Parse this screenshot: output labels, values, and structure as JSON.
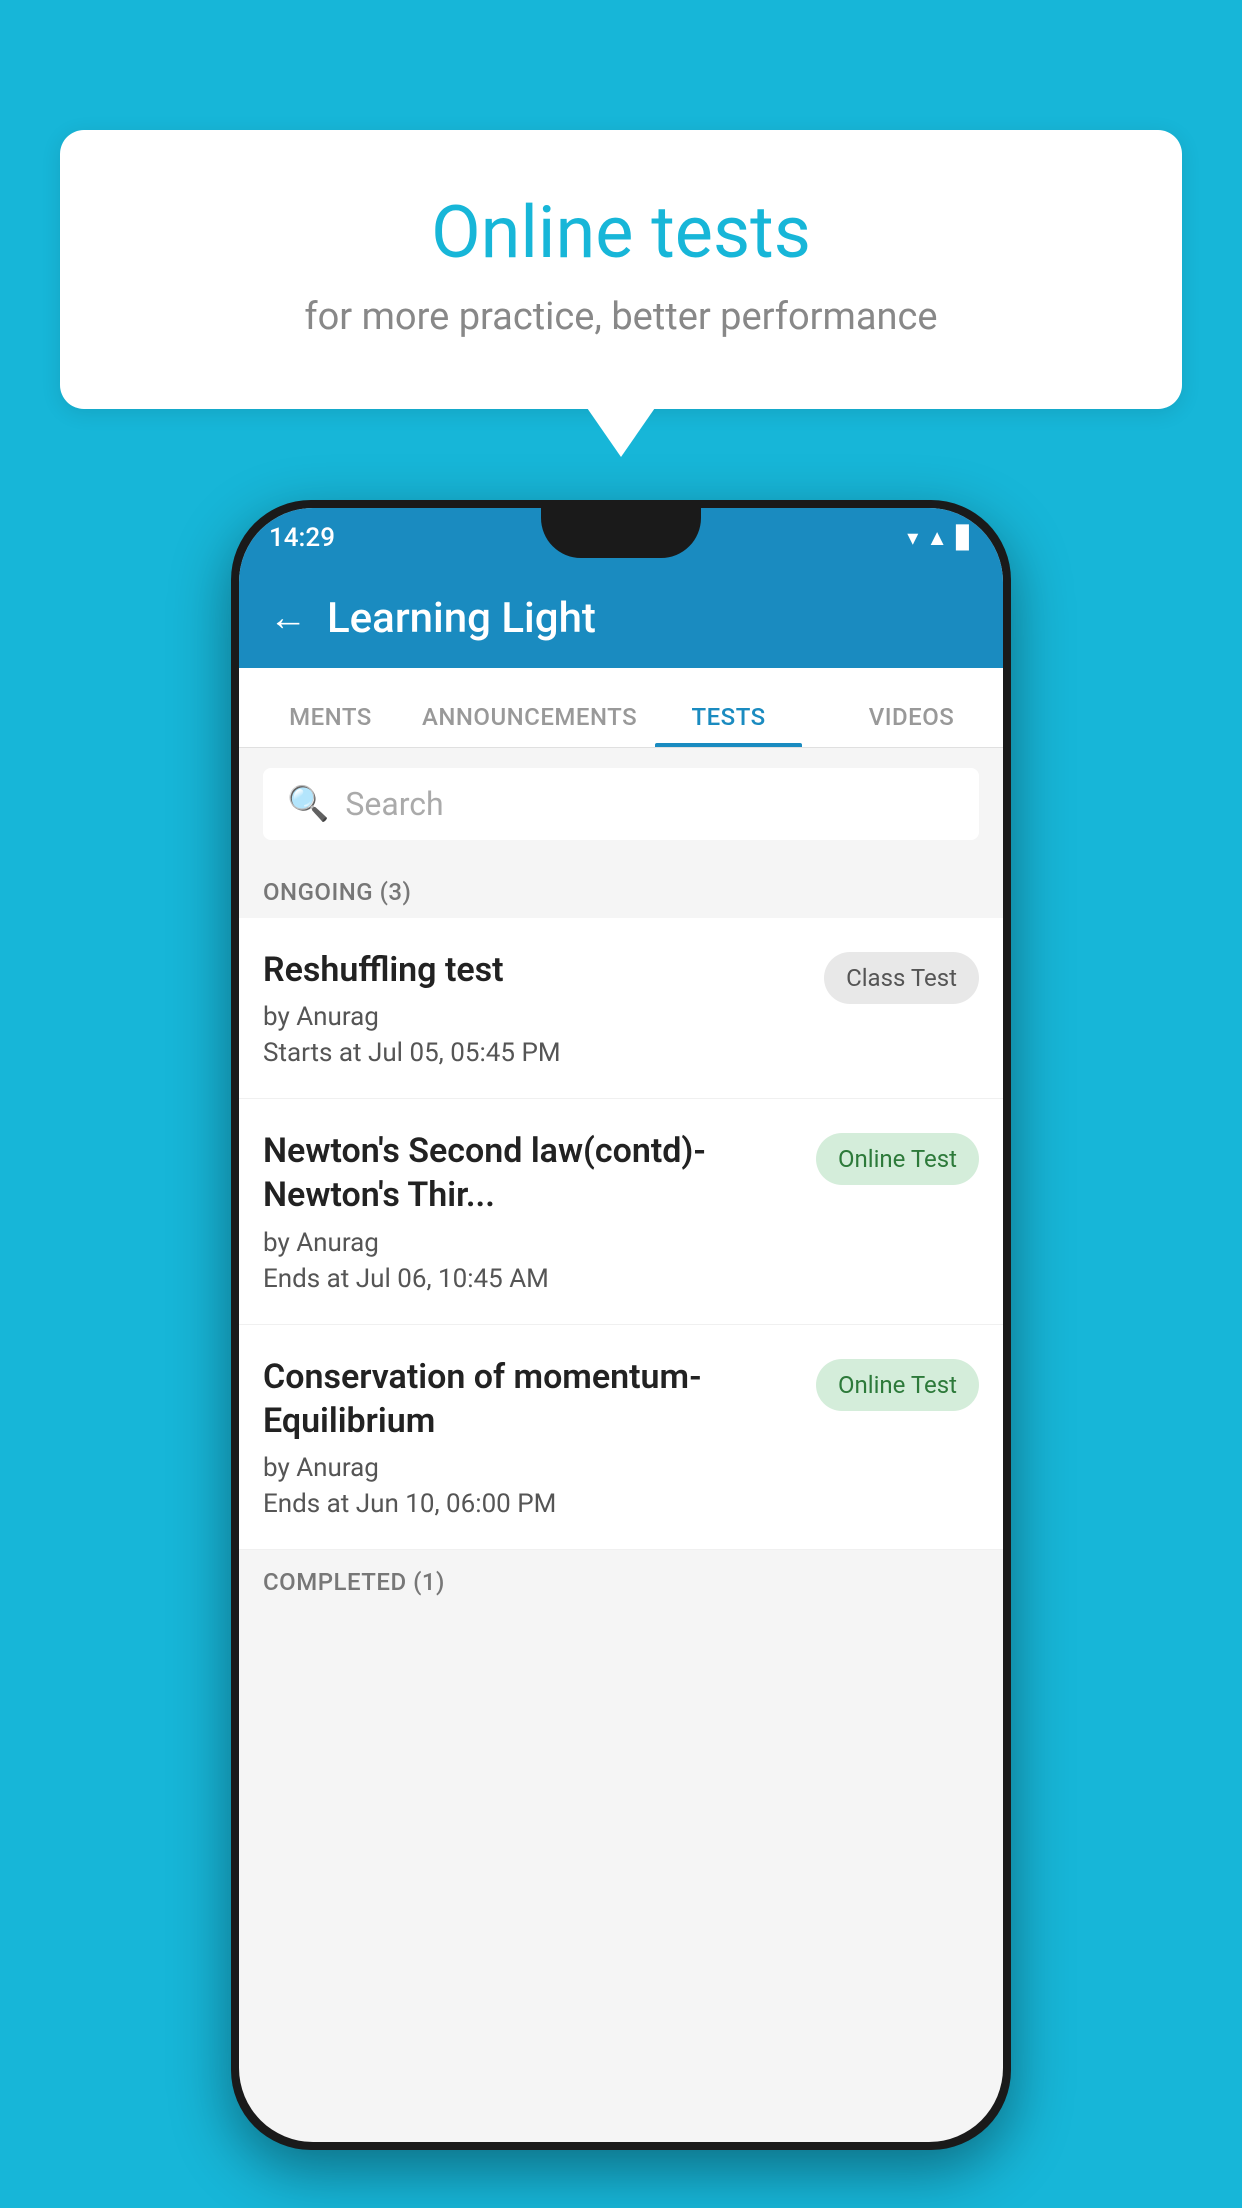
{
  "background": {
    "color": "#17b6d8"
  },
  "speech_bubble": {
    "title": "Online tests",
    "subtitle": "for more practice, better performance"
  },
  "phone": {
    "status_bar": {
      "time": "14:29",
      "wifi": "▾",
      "signal": "▲",
      "battery": "▊"
    },
    "app_bar": {
      "back_label": "←",
      "title": "Learning Light"
    },
    "tabs": [
      {
        "label": "MENTS",
        "active": false
      },
      {
        "label": "ANNOUNCEMENTS",
        "active": false
      },
      {
        "label": "TESTS",
        "active": true
      },
      {
        "label": "VIDEOS",
        "active": false
      }
    ],
    "search": {
      "placeholder": "Search"
    },
    "sections": [
      {
        "header": "ONGOING (3)",
        "items": [
          {
            "name": "Reshuffling test",
            "author": "by Anurag",
            "date": "Starts at  Jul 05, 05:45 PM",
            "badge": "Class Test",
            "badge_type": "class"
          },
          {
            "name": "Newton's Second law(contd)-Newton's Thir...",
            "author": "by Anurag",
            "date": "Ends at  Jul 06, 10:45 AM",
            "badge": "Online Test",
            "badge_type": "online"
          },
          {
            "name": "Conservation of momentum-Equilibrium",
            "author": "by Anurag",
            "date": "Ends at  Jun 10, 06:00 PM",
            "badge": "Online Test",
            "badge_type": "online"
          }
        ]
      }
    ],
    "completed_header": "COMPLETED (1)"
  }
}
